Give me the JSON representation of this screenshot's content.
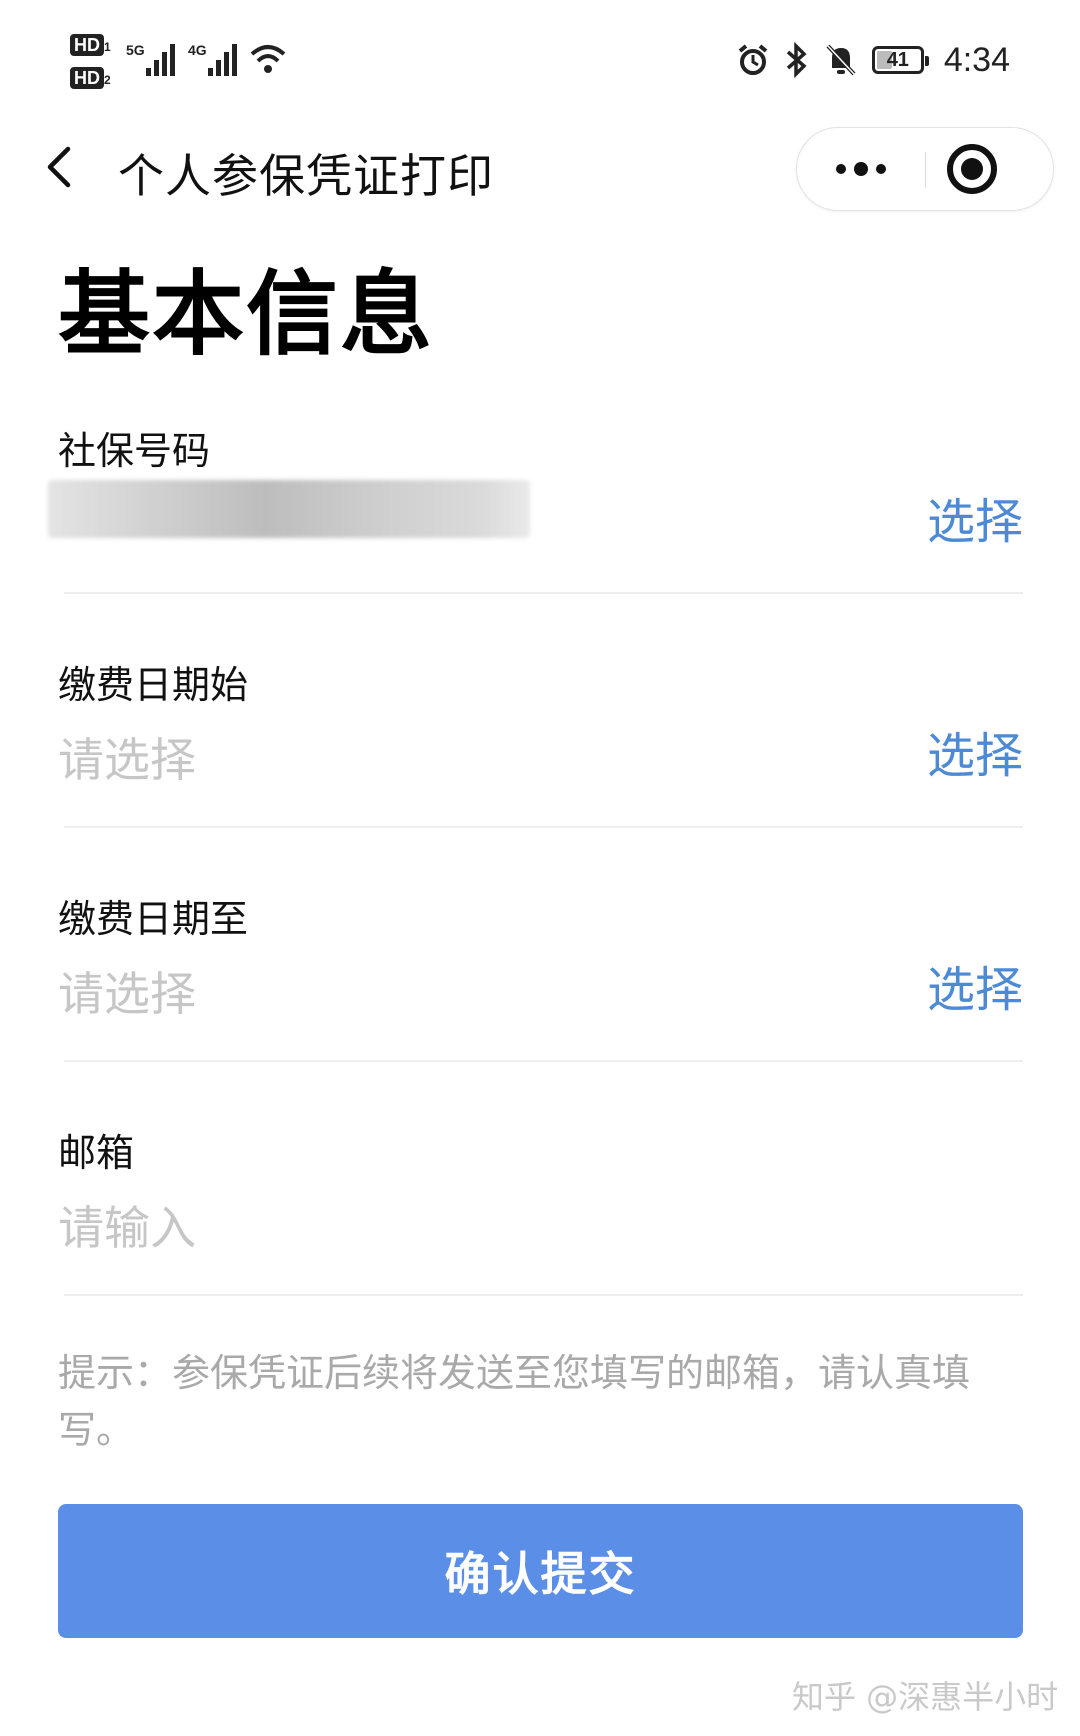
{
  "status_bar": {
    "sim1": "HD",
    "sim1_num": "1",
    "sim2": "HD",
    "sim2_num": "2",
    "network1": "5G",
    "network2": "4G",
    "battery": "41",
    "battery_level": 0.41,
    "time": "4:34",
    "icons": [
      "signal-icon",
      "wifi-icon",
      "alarm-icon",
      "bluetooth-icon",
      "mute-icon",
      "battery-icon"
    ]
  },
  "nav": {
    "title": "个人参保凭证打印",
    "back_icon": "chevron-left-icon",
    "more_icon": "more-dots-icon",
    "close_icon": "target-circle-icon"
  },
  "heading": "基本信息",
  "form": {
    "social_security": {
      "label": "社保号码",
      "value_redacted": true,
      "action": "选择"
    },
    "date_start": {
      "label": "缴费日期始",
      "placeholder": "请选择",
      "action": "选择"
    },
    "date_end": {
      "label": "缴费日期至",
      "placeholder": "请选择",
      "action": "选择"
    },
    "email": {
      "label": "邮箱",
      "placeholder": "请输入"
    }
  },
  "hint": "提示：参保凭证后续将发送至您填写的邮箱，请认真填写。",
  "submit_label": "确认提交",
  "watermark": "知乎 @深惠半小时",
  "colors": {
    "accent": "#4d8ad6",
    "button": "#5b8ee6",
    "placeholder": "#c6c6c6",
    "hint": "#a9a9a9"
  }
}
